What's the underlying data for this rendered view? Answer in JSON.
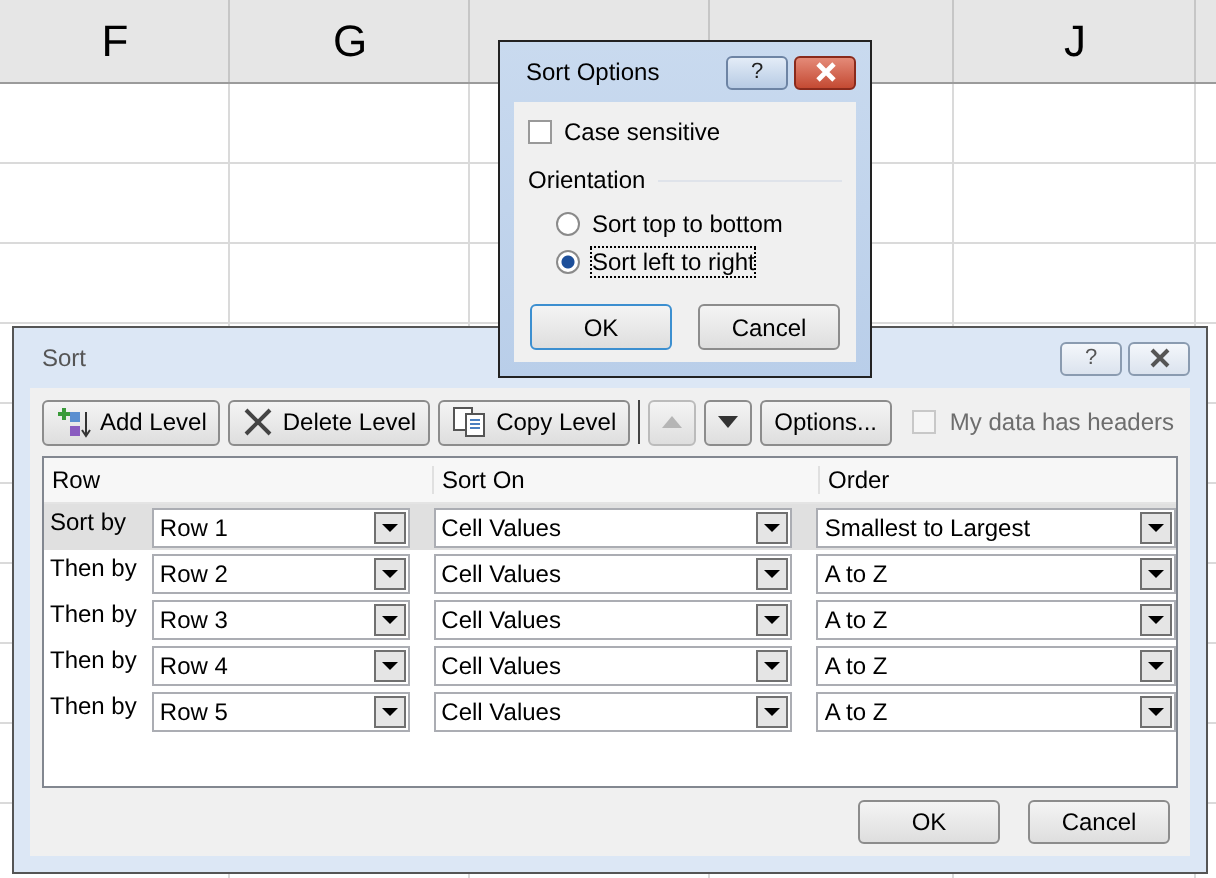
{
  "sheet": {
    "column_headers": [
      "F",
      "G",
      "J"
    ]
  },
  "sort_dialog": {
    "title": "Sort",
    "help": "?",
    "toolbar": [
      {
        "kind": "add",
        "label": "Add Level",
        "disabled": false
      },
      {
        "kind": "delete",
        "label": "Delete Level",
        "disabled": false
      },
      {
        "kind": "copy",
        "label": "Copy Level",
        "disabled": false
      },
      {
        "kind": "up",
        "disabled": true
      },
      {
        "kind": "down",
        "disabled": false
      },
      {
        "kind": "options",
        "label": "Options...",
        "disabled": false
      }
    ],
    "headers_checkbox": {
      "label": "My data has headers",
      "checked": false,
      "disabled": true
    },
    "columns": [
      "Row",
      "Sort On",
      "Order"
    ],
    "levels": [
      {
        "label": "Sort by",
        "column": "Row 1",
        "sort_on": "Cell Values",
        "order": "Smallest to Largest",
        "selected": true
      },
      {
        "label": "Then by",
        "column": "Row 2",
        "sort_on": "Cell Values",
        "order": "A to Z",
        "selected": false
      },
      {
        "label": "Then by",
        "column": "Row 3",
        "sort_on": "Cell Values",
        "order": "A to Z",
        "selected": false
      },
      {
        "label": "Then by",
        "column": "Row 4",
        "sort_on": "Cell Values",
        "order": "A to Z",
        "selected": false
      },
      {
        "label": "Then by",
        "column": "Row 5",
        "sort_on": "Cell Values",
        "order": "A to Z",
        "selected": false
      }
    ],
    "buttons": [
      "OK",
      "Cancel"
    ]
  },
  "sort_options": {
    "title": "Sort Options",
    "help": "?",
    "case_sensitive": {
      "label": "Case sensitive",
      "checked": false
    },
    "orientation_label": "Orientation",
    "orientations": [
      {
        "label": "Sort top to bottom",
        "selected": false
      },
      {
        "label": "Sort left to right",
        "selected": true
      }
    ],
    "buttons": [
      "OK",
      "Cancel"
    ]
  }
}
